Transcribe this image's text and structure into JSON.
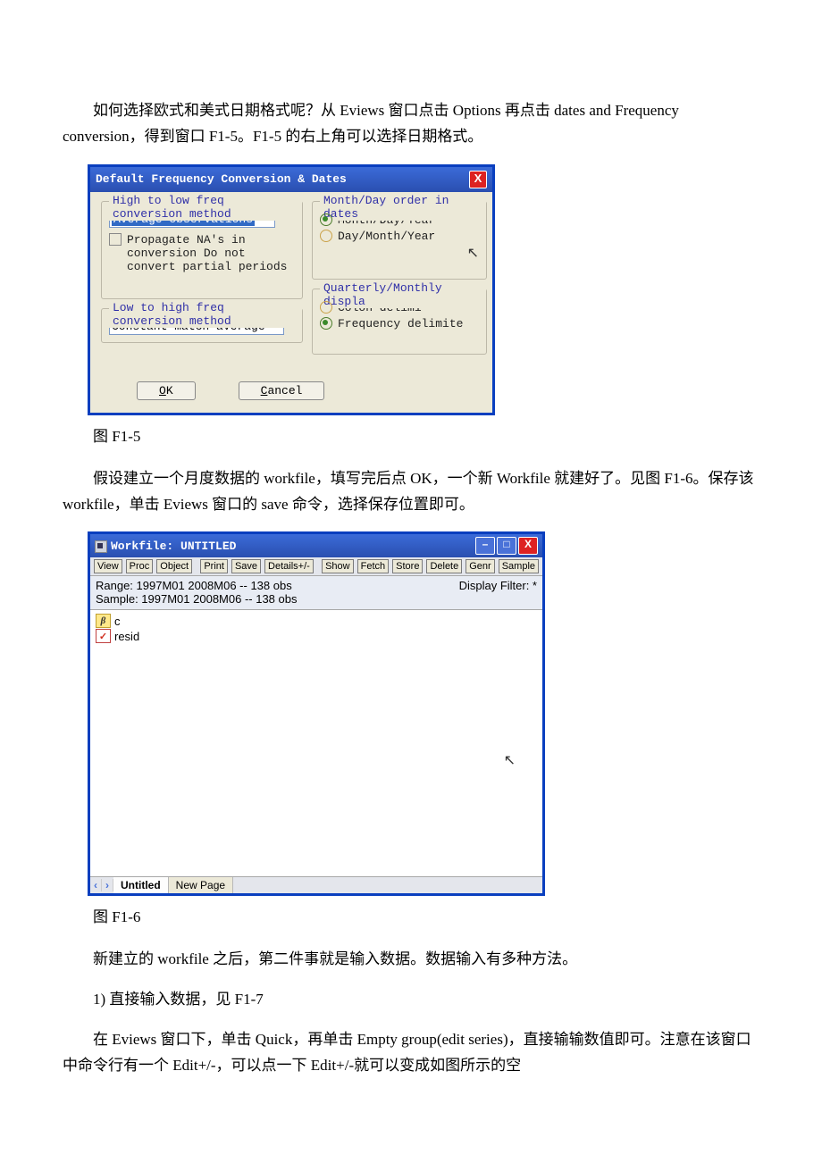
{
  "para1": "如何选择欧式和美式日期格式呢？从 Eviews 窗口点击 Options 再点击 dates and Frequency conversion，得到窗口 F1-5。F1-5 的右上角可以选择日期格式。",
  "d1": {
    "title": "Default Frequency Conversion & Dates",
    "g1": "High to low freq conversion method",
    "sel1": "Average observations",
    "chk1a": "Propagate NA's in",
    "chk1b": "conversion  Do not",
    "chk1c": "convert partial periods",
    "g2": "Low to high freq conversion method",
    "sel2": "Constant-match average",
    "g3": "Month/Day order in dates",
    "r1": "Month/Day/Year",
    "r2": "Day/Month/Year",
    "g4": "Quarterly/Monthly displa",
    "r3": "Colon delimi",
    "r4": "Frequency delimite",
    "ok": "OK",
    "cancel": "Cancel"
  },
  "cap1": "图 F1-5",
  "para2": "假设建立一个月度数据的 workfile，填写完后点 OK，一个新 Workfile 就建好了。见图 F1-6。保存该 workfile，单击 Eviews 窗口的 save 命令，选择保存位置即可。",
  "wf": {
    "title": "Workfile: UNTITLED",
    "tb": [
      "View",
      "Proc",
      "Object",
      "Print",
      "Save",
      "Details+/-",
      "Show",
      "Fetch",
      "Store",
      "Delete",
      "Genr",
      "Sample"
    ],
    "range": "Range:  1997M01 2008M06   --   138 obs",
    "sample": "Sample: 1997M01 2008M06   --   138 obs",
    "filter": "Display Filter: *",
    "obj_c": "c",
    "obj_resid": "resid",
    "tab_active": "Untitled",
    "tab_new": "New Page"
  },
  "cap2": "图 F1-6",
  "para3": "新建立的 workfile 之后，第二件事就是输入数据。数据输入有多种方法。",
  "para4": "1) 直接输入数据，见 F1-7",
  "para5": "在 Eviews 窗口下，单击 Quick，再单击 Empty group(edit series)，直接输输数值即可。注意在该窗口中命令行有一个 Edit+/-，可以点一下 Edit+/-就可以变成如图所示的空"
}
